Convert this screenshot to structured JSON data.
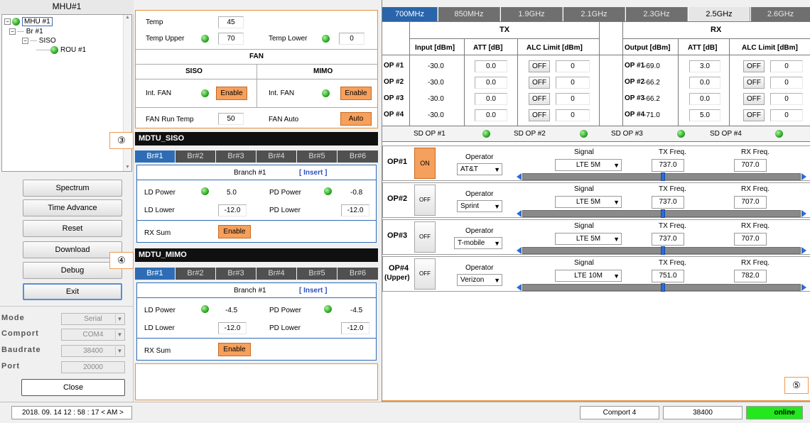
{
  "tree": {
    "title": "MHU#1",
    "nodes": [
      "MHU #1",
      "Br #1",
      "SISO",
      "ROU #1"
    ]
  },
  "left_buttons": {
    "spectrum": "Spectrum",
    "time_advance": "Time Advance",
    "reset": "Reset",
    "download": "Download",
    "debug": "Debug",
    "exit": "Exit",
    "close": "Close"
  },
  "settings": {
    "mode_label": "Mode",
    "mode_value": "Serial",
    "comport_label": "Comport",
    "comport_value": "COM4",
    "baudrate_label": "Baudrate",
    "baudrate_value": "38400",
    "port_label": "Port",
    "port_value": "20000"
  },
  "temp": {
    "temp_label": "Temp",
    "temp_value": "45",
    "upper_label": "Temp Upper",
    "upper_value": "70",
    "lower_label": "Temp Lower",
    "lower_value": "0"
  },
  "fan": {
    "title": "FAN",
    "siso": "SISO",
    "mimo": "MIMO",
    "int_fan": "Int. FAN",
    "enable": "Enable",
    "run_temp_label": "FAN Run Temp",
    "run_temp_value": "50",
    "auto_label": "FAN Auto",
    "auto_btn": "Auto"
  },
  "mdtu_siso": {
    "title": "MDTU_SISO",
    "tabs": [
      "Br#1",
      "Br#2",
      "Br#3",
      "Br#4",
      "Br#5",
      "Br#6"
    ],
    "branch": "Branch #1",
    "insert": "[ Insert ]",
    "ld_power_label": "LD Power",
    "ld_power": "5.0",
    "pd_power_label": "PD Power",
    "pd_power": "-0.8",
    "ld_lower_label": "LD Lower",
    "ld_lower": "-12.0",
    "pd_lower_label": "PD Lower",
    "pd_lower": "-12.0",
    "rx_sum_label": "RX Sum",
    "rx_sum_btn": "Enable"
  },
  "mdtu_mimo": {
    "title": "MDTU_MIMO",
    "tabs": [
      "Br#1",
      "Br#2",
      "Br#3",
      "Br#4",
      "Br#5",
      "Br#6"
    ],
    "branch": "Branch #1",
    "insert": "[ Insert ]",
    "ld_power_label": "LD Power",
    "ld_power": "-4.5",
    "pd_power_label": "PD Power",
    "pd_power": "-4.5",
    "ld_lower_label": "LD Lower",
    "ld_lower": "-12.0",
    "pd_lower_label": "PD Lower",
    "pd_lower": "-12.0",
    "rx_sum_label": "RX Sum",
    "rx_sum_btn": "Enable"
  },
  "callouts": {
    "c3": "③",
    "c4": "④",
    "c5": "⑤"
  },
  "freq_tabs": [
    "700MHz",
    "850MHz",
    "1.9GHz",
    "2.1GHz",
    "2.3GHz",
    "2.5GHz",
    "2.6GHz"
  ],
  "txrx": {
    "tx_title": "TX",
    "rx_title": "RX",
    "tx_headers": [
      "Input [dBm]",
      "ATT [dB]",
      "ALC Limit [dBm]"
    ],
    "rx_headers": [
      "Output [dBm]",
      "ATT [dB]",
      "ALC Limit [dBm]"
    ],
    "off": "OFF",
    "rows": [
      {
        "op": "OP #1",
        "tx_in": "-30.0",
        "tx_att": "0.0",
        "tx_alc": "0",
        "rx_out": "-69.0",
        "rx_att": "3.0",
        "rx_alc": "0"
      },
      {
        "op": "OP #2",
        "tx_in": "-30.0",
        "tx_att": "0.0",
        "tx_alc": "0",
        "rx_out": "-66.2",
        "rx_att": "0.0",
        "rx_alc": "0"
      },
      {
        "op": "OP #3",
        "tx_in": "-30.0",
        "tx_att": "0.0",
        "tx_alc": "0",
        "rx_out": "-66.2",
        "rx_att": "0.0",
        "rx_alc": "0"
      },
      {
        "op": "OP #4",
        "tx_in": "-30.0",
        "tx_att": "0.0",
        "tx_alc": "0",
        "rx_out": "-71.0",
        "rx_att": "5.0",
        "rx_alc": "0"
      }
    ]
  },
  "sd": [
    "SD OP #1",
    "SD OP #2",
    "SD OP #3",
    "SD OP #4"
  ],
  "ops": {
    "operator_label": "Operator",
    "signal_label": "Signal",
    "tx_label": "TX Freq.",
    "rx_label": "RX Freq.",
    "rows": [
      {
        "name": "OP#1",
        "state": "ON",
        "operator": "AT&T",
        "signal": "LTE 5M",
        "tx": "737.0",
        "rx": "707.0"
      },
      {
        "name": "OP#2",
        "state": "OFF",
        "operator": "Sprint",
        "signal": "LTE 5M",
        "tx": "737.0",
        "rx": "707.0"
      },
      {
        "name": "OP#3",
        "state": "OFF",
        "operator": "T-mobile",
        "signal": "LTE 5M",
        "tx": "737.0",
        "rx": "707.0"
      },
      {
        "name": "OP#4",
        "name2": "(Upper)",
        "state": "OFF",
        "operator": "Verizon",
        "signal": "LTE 10M",
        "tx": "751.0",
        "rx": "782.0"
      }
    ]
  },
  "status": {
    "datetime": "2018. 09. 14   12 : 58 : 17 < AM >",
    "comport": "Comport 4",
    "baud": "38400",
    "online": "online",
    "online_color": "#22e81d"
  }
}
